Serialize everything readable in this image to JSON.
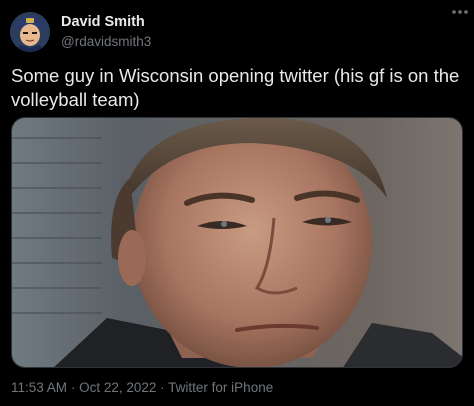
{
  "tweet": {
    "author": {
      "display_name": "David Smith",
      "handle": "@rdavidsmith3",
      "avatar_icon": "avatar-anime-character"
    },
    "more_icon": "more-horizontal-icon",
    "text": "Some guy in Wisconsin opening twitter (his gf is on the volleyball team)",
    "media": {
      "type": "image"
    },
    "meta": {
      "time": "11:53 AM",
      "separator_1": "·",
      "date": "Oct 22, 2022",
      "separator_2": "·",
      "source": "Twitter for iPhone"
    }
  },
  "colors": {
    "background": "#000000",
    "primary_text": "#e7e9ea",
    "secondary_text": "#71767b",
    "border": "#2f3336"
  }
}
